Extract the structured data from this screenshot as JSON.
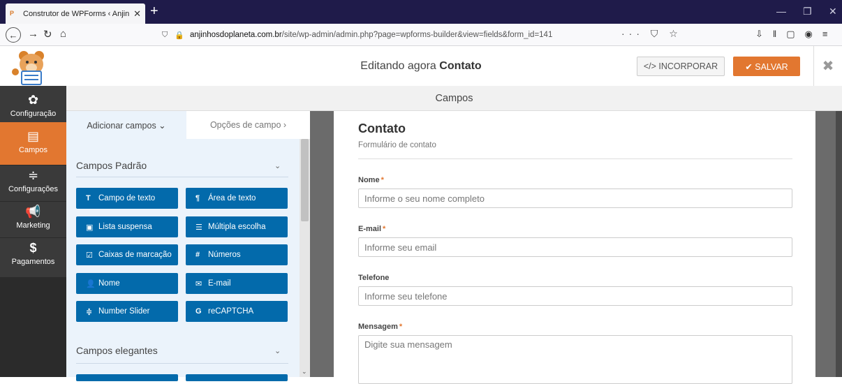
{
  "browser": {
    "tab_title": "Construtor de WPForms ‹ Anjin",
    "tab_close": "✕",
    "new_tab": "+",
    "url_host": "anjinhosdoplaneta.com.br",
    "url_path": "/site/wp-admin/admin.php?page=wpforms-builder&view=fields&form_id=141"
  },
  "toolbar": {
    "editing_prefix": "Editando agora",
    "form_name": "Contato",
    "embed_label": "</> INCORPORAR",
    "save_label": "✔ SALVAR",
    "close_label": "✖"
  },
  "sidebar": {
    "items": [
      {
        "label": "Configuração",
        "icon": "gear-icon"
      },
      {
        "label": "Campos",
        "icon": "fields-icon"
      },
      {
        "label": "Configurações",
        "icon": "sliders-icon"
      },
      {
        "label": "Marketing",
        "icon": "megaphone-icon"
      },
      {
        "label": "Pagamentos",
        "icon": "dollar-icon"
      }
    ]
  },
  "section_title": "Campos",
  "panel": {
    "tab_add": "Adicionar campos ⌄",
    "tab_options": "Opções de campo ›",
    "group_standard": "Campos Padrão",
    "group_fancy": "Campos elegantes",
    "buttons": [
      {
        "label": "Campo de texto",
        "icon": "T"
      },
      {
        "label": "Área de texto",
        "icon": "¶"
      },
      {
        "label": "Lista suspensa",
        "icon": "▣"
      },
      {
        "label": "Múltipla escolha",
        "icon": "☰"
      },
      {
        "label": "Caixas de marcação",
        "icon": "☑"
      },
      {
        "label": "Números",
        "icon": "#"
      },
      {
        "label": "Nome",
        "icon": "👤"
      },
      {
        "label": "E-mail",
        "icon": "✉"
      },
      {
        "label": "Number Slider",
        "icon": "≑"
      },
      {
        "label": "reCAPTCHA",
        "icon": "G"
      }
    ]
  },
  "form": {
    "title": "Contato",
    "description": "Formulário de contato",
    "fields": [
      {
        "label": "Nome",
        "required": "*",
        "placeholder": "Informe o seu nome completo"
      },
      {
        "label": "E-mail",
        "required": "*",
        "placeholder": "Informe seu email"
      },
      {
        "label": "Telefone",
        "required": "",
        "placeholder": "Informe seu telefone"
      },
      {
        "label": "Mensagem",
        "required": "*",
        "placeholder": "Digite sua mensagem"
      }
    ]
  },
  "colors": {
    "accent": "#e27730",
    "field_button": "#036aab",
    "sidebar": "#3a3a3a",
    "browser_bar": "#1f1b4a"
  }
}
